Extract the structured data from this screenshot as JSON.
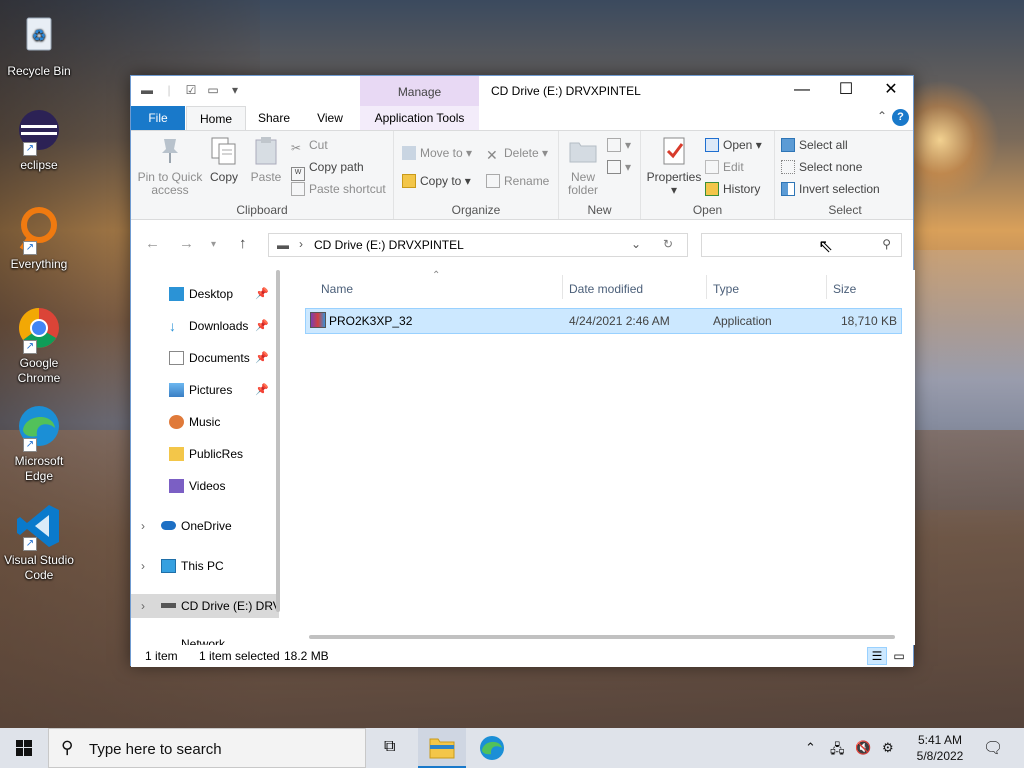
{
  "desktop": {
    "icons": [
      {
        "label": "Recycle Bin"
      },
      {
        "label": "eclipse"
      },
      {
        "label": "Everything"
      },
      {
        "label": "Google Chrome"
      },
      {
        "label": "Microsoft Edge"
      },
      {
        "label": "Visual Studio Code"
      }
    ]
  },
  "window": {
    "title": "CD Drive (E:) DRVXPINTEL",
    "manage_label": "Manage",
    "tabs": {
      "file": "File",
      "home": "Home",
      "share": "Share",
      "view": "View",
      "app_tools": "Application Tools"
    },
    "help": "?"
  },
  "ribbon": {
    "clipboard": {
      "pin": "Pin to Quick access",
      "pin_line1": "Pin to Quick",
      "pin_line2": "access",
      "copy": "Copy",
      "paste": "Paste",
      "cut": "Cut",
      "copy_path": "Copy path",
      "paste_shortcut": "Paste shortcut",
      "label": "Clipboard"
    },
    "organize": {
      "move_to": "Move to",
      "copy_to": "Copy to",
      "delete": "Delete",
      "rename": "Rename",
      "label": "Organize"
    },
    "new": {
      "new_folder_line1": "New",
      "new_folder_line2": "folder",
      "label": "New"
    },
    "open": {
      "properties": "Properties",
      "open": "Open",
      "edit": "Edit",
      "history": "History",
      "label": "Open"
    },
    "select": {
      "select_all": "Select all",
      "select_none": "Select none",
      "invert": "Invert selection",
      "label": "Select"
    }
  },
  "address": {
    "path": "CD Drive (E:) DRVXPINTEL",
    "search_placeholder": ""
  },
  "nav": {
    "items": [
      {
        "label": "Desktop"
      },
      {
        "label": "Downloads"
      },
      {
        "label": "Documents"
      },
      {
        "label": "Pictures"
      },
      {
        "label": "Music"
      },
      {
        "label": "PublicRes"
      },
      {
        "label": "Videos"
      },
      {
        "label": "OneDrive"
      },
      {
        "label": "This PC"
      },
      {
        "label": "CD Drive (E:) DRV"
      },
      {
        "label": "Network"
      }
    ]
  },
  "columns": {
    "name": "Name",
    "date": "Date modified",
    "type": "Type",
    "size": "Size"
  },
  "files": [
    {
      "name": "PRO2K3XP_32",
      "date": "4/24/2021 2:46 AM",
      "type": "Application",
      "size": "18,710 KB"
    }
  ],
  "status": {
    "count": "1 item",
    "selected": "1 item selected",
    "size": "18.2 MB"
  },
  "taskbar": {
    "search_text": "Type here to search",
    "time": "5:41 AM",
    "date": "5/8/2022"
  },
  "colors": {
    "file_tab": "#1979ca",
    "selection": "#cce8ff",
    "manage_tab": "#e8d9f4"
  }
}
